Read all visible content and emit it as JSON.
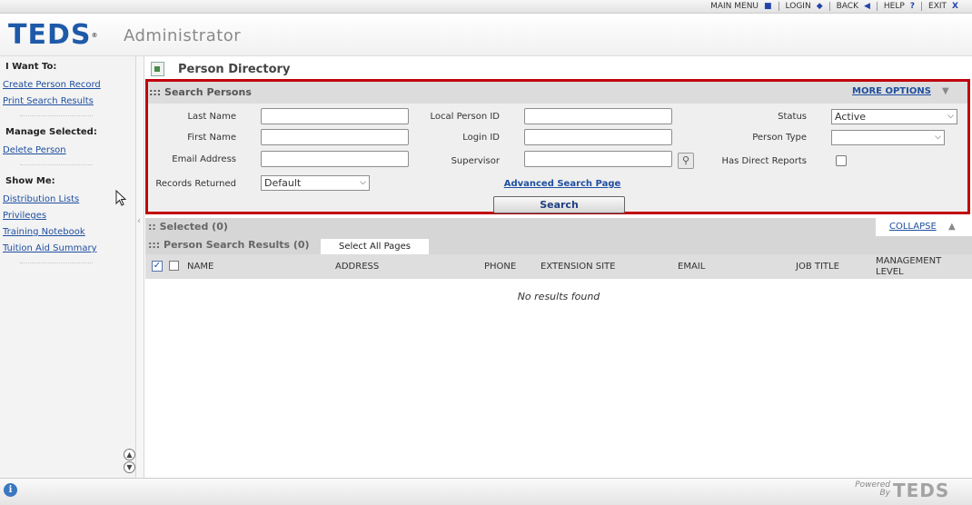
{
  "topnav": [
    {
      "label": "MAIN MENU",
      "icon": "■"
    },
    {
      "label": "LOGIN",
      "icon": "◆"
    },
    {
      "label": "BACK",
      "icon": "◀"
    },
    {
      "label": "HELP",
      "icon": "?"
    },
    {
      "label": "EXIT",
      "icon": "X"
    }
  ],
  "header": {
    "logo": "TEDS",
    "app": "Administrator"
  },
  "sidebar": {
    "i_want_to": "I Want To:",
    "create_person": "Create Person Record",
    "print_results": "Print Search Results",
    "manage_selected": "Manage Selected:",
    "delete_person": "Delete Person",
    "show_me": "Show Me:",
    "distribution_lists": "Distribution Lists",
    "privileges": "Privileges",
    "training_notebook": "Training Notebook",
    "tuition_aid": "Tuition Aid Summary"
  },
  "page": {
    "title": "Person Directory"
  },
  "search": {
    "title": "::: Search Persons",
    "more_options": "MORE OPTIONS",
    "last_name": "Last Name",
    "first_name": "First Name",
    "email": "Email Address",
    "records_returned": "Records Returned",
    "records_returned_value": "Default",
    "local_person_id": "Local Person ID",
    "login_id": "Login ID",
    "supervisor": "Supervisor",
    "status": "Status",
    "status_value": "Active",
    "person_type": "Person Type",
    "person_type_value": "",
    "has_direct_reports": "Has Direct Reports",
    "advanced": "Advanced Search Page",
    "search_button": "Search"
  },
  "selected": {
    "title": ":: Selected (0)",
    "collapse": "COLLAPSE"
  },
  "results": {
    "title": "::: Person Search Results (0)",
    "select_all": "Select All Pages",
    "columns": [
      "NAME",
      "ADDRESS",
      "PHONE",
      "EXTENSION SITE",
      "EMAIL",
      "JOB TITLE",
      "MANAGEMENT LEVEL"
    ],
    "empty": "No results found"
  },
  "footer": {
    "powered": "Powered By",
    "logo": "TEDS"
  }
}
